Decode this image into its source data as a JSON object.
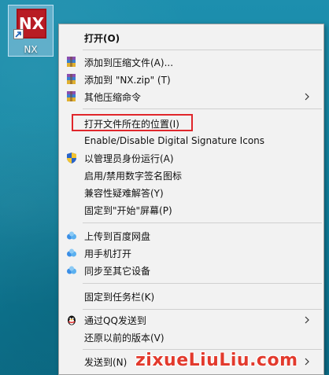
{
  "desktop": {
    "icon_tile_text": "NX",
    "icon_label": "NX"
  },
  "menu": {
    "items": [
      {
        "label": "打开(O)",
        "icon": "none"
      },
      {
        "label": "添加到压缩文件(A)...",
        "icon": "winrar-archive-icon"
      },
      {
        "label": "添加到 \"NX.zip\" (T)",
        "icon": "winrar-archive-icon"
      },
      {
        "label": "其他压缩命令",
        "icon": "winrar-archive-icon"
      },
      {
        "label": "打开文件所在的位置(I)",
        "icon": "none"
      },
      {
        "label": "Enable/Disable Digital Signature Icons",
        "icon": "none"
      },
      {
        "label": "以管理员身份运行(A)",
        "icon": "uac-shield-icon"
      },
      {
        "label": "启用/禁用数字签名图标",
        "icon": "none"
      },
      {
        "label": "兼容性疑难解答(Y)",
        "icon": "none"
      },
      {
        "label": "固定到\"开始\"屏幕(P)",
        "icon": "none"
      },
      {
        "label": "上传到百度网盘",
        "icon": "baidu-netdisk-icon"
      },
      {
        "label": "用手机打开",
        "icon": "baidu-netdisk-icon"
      },
      {
        "label": "同步至其它设备",
        "icon": "baidu-netdisk-icon"
      },
      {
        "label": "固定到任务栏(K)",
        "icon": "none"
      },
      {
        "label": "通过QQ发送到",
        "icon": "qq-penguin-icon"
      },
      {
        "label": "还原以前的版本(V)",
        "icon": "none"
      },
      {
        "label": "发送到(N)",
        "icon": "none"
      }
    ]
  },
  "watermark": "zixueLiuLiu.com",
  "colors": {
    "menu_bg": "#f2f2f2",
    "highlight": "#e0262b",
    "nx_red": "#b81c24"
  }
}
